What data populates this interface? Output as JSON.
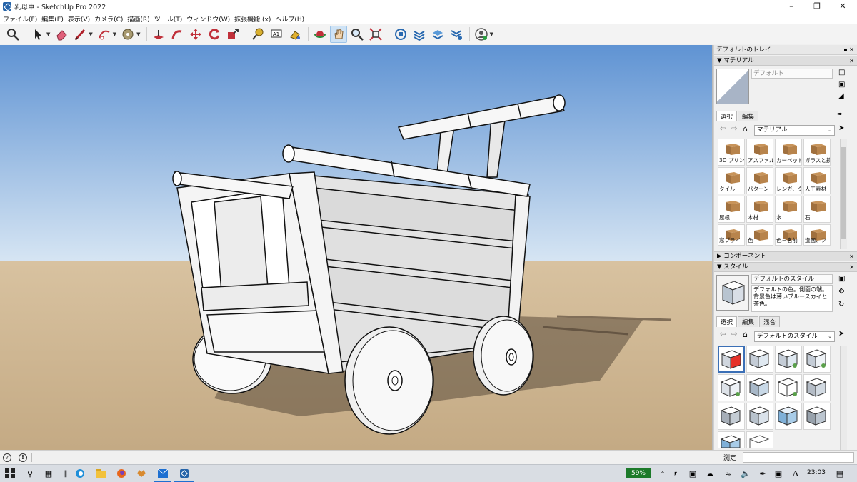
{
  "window": {
    "title": "乳母車 - SketchUp Pro 2022"
  },
  "menu": [
    "ファイル(F)",
    "編集(E)",
    "表示(V)",
    "カメラ(C)",
    "描画(R)",
    "ツール(T)",
    "ウィンドウ(W)",
    "拡張機能 (x)",
    "ヘルプ(H)"
  ],
  "icons": {
    "tools": [
      "zoom-window-icon",
      "select-icon",
      "eraser-icon",
      "line-icon",
      "arc-icon",
      "paint-bucket-icon",
      "push-pull-icon",
      "follow-me-icon",
      "move-icon",
      "rotate-icon",
      "scale-icon",
      "tape-measure-icon",
      "text-icon",
      "paint-icon",
      "orbit-icon",
      "pan-icon",
      "zoom-icon",
      "zoom-extents-icon",
      "warehouse-icon",
      "extension-warehouse-icon",
      "layout-icon",
      "extension-manager-icon",
      "account-icon"
    ]
  },
  "tray": {
    "title": "デフォルトのトレイ",
    "materials": {
      "header": "マテリアル",
      "current_name": "デフォルト",
      "tabs": [
        "選択",
        "編集"
      ],
      "library": "マテリアル",
      "items": [
        "3D プリント",
        "アスファル",
        "カーペット",
        "ガラスと鏡",
        "タイル",
        "パターン",
        "レンガ、ク",
        "人工素材",
        "屋根",
        "木材",
        "水",
        "石",
        "窓ブライ",
        "色",
        "色－名前",
        "造園、フ"
      ]
    },
    "components": {
      "header": "コンポーネント"
    },
    "styles": {
      "header": "スタイル",
      "current_name": "デフォルトのスタイル",
      "description": "デフォルトの色。側面の端。背景色は薄いブルースカイと茶色。",
      "tabs": [
        "選択",
        "編集",
        "混合"
      ],
      "library": "デフォルトのスタイル"
    }
  },
  "status": {
    "measure_label": "測定",
    "measure_value": ""
  },
  "taskbar": {
    "battery": "59%",
    "time": "23:03"
  },
  "colors": {
    "sky_top": "#5f93d3",
    "sky_bottom": "#d6e5f3",
    "ground": "#d1b895",
    "accent": "#2563a8"
  }
}
